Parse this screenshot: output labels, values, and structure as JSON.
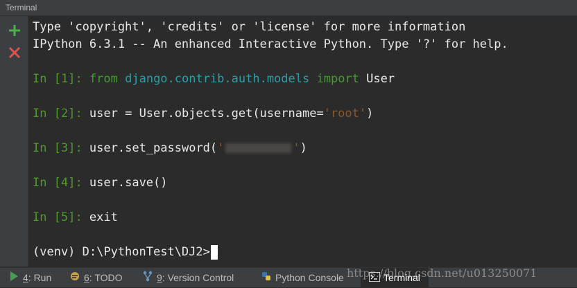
{
  "window": {
    "title": "Terminal"
  },
  "toolbar": {
    "add_icon": "plus-icon",
    "close_icon": "close-icon"
  },
  "terminal": {
    "banner1": "Type 'copyright', 'credits' or 'license' for more information",
    "banner2": "IPython 6.3.1 -- An enhanced Interactive Python. Type '?' for help.",
    "cells": [
      {
        "prompt_in": "In [",
        "num": "1",
        "prompt_close": "]: ",
        "parts": {
          "kw1": "from",
          "mod": "django.contrib.auth.models",
          "kw2": "import",
          "rest": "User"
        }
      },
      {
        "prompt_in": "In [",
        "num": "2",
        "prompt_close": "]: ",
        "parts": {
          "code": "user = User.objects.get(username=",
          "str": "'root'",
          "end": ")"
        }
      },
      {
        "prompt_in": "In [",
        "num": "3",
        "prompt_close": "]: ",
        "parts": {
          "code": "user.set_password(",
          "str_open": "'",
          "str_close": "'",
          "end": ")"
        }
      },
      {
        "prompt_in": "In [",
        "num": "4",
        "prompt_close": "]: ",
        "parts": {
          "code": "user.save()"
        }
      },
      {
        "prompt_in": "In [",
        "num": "5",
        "prompt_close": "]: ",
        "parts": {
          "code": "exit"
        }
      }
    ],
    "shell_prompt": "(venv) D:\\PythonTest\\DJ2>"
  },
  "bottom_tabs": [
    {
      "num": "4",
      "label": ": Run",
      "icon": "run-icon"
    },
    {
      "num": "6",
      "label": ": TODO",
      "icon": "todo-icon"
    },
    {
      "num": "9",
      "label": ": Version Control",
      "icon": "version-control-icon"
    },
    {
      "label": "Python Console",
      "icon": "python-icon"
    },
    {
      "label": "Terminal",
      "icon": "terminal-icon",
      "active": true
    }
  ],
  "watermark": "https://blog.csdn.net/u013250071",
  "colors": {
    "background": "#2b2b2b",
    "prompt": "#4e9a28",
    "keyword": "#3fa028",
    "module": "#29a0a8",
    "string": "#8b5a2b",
    "text": "#e8e8e8"
  }
}
